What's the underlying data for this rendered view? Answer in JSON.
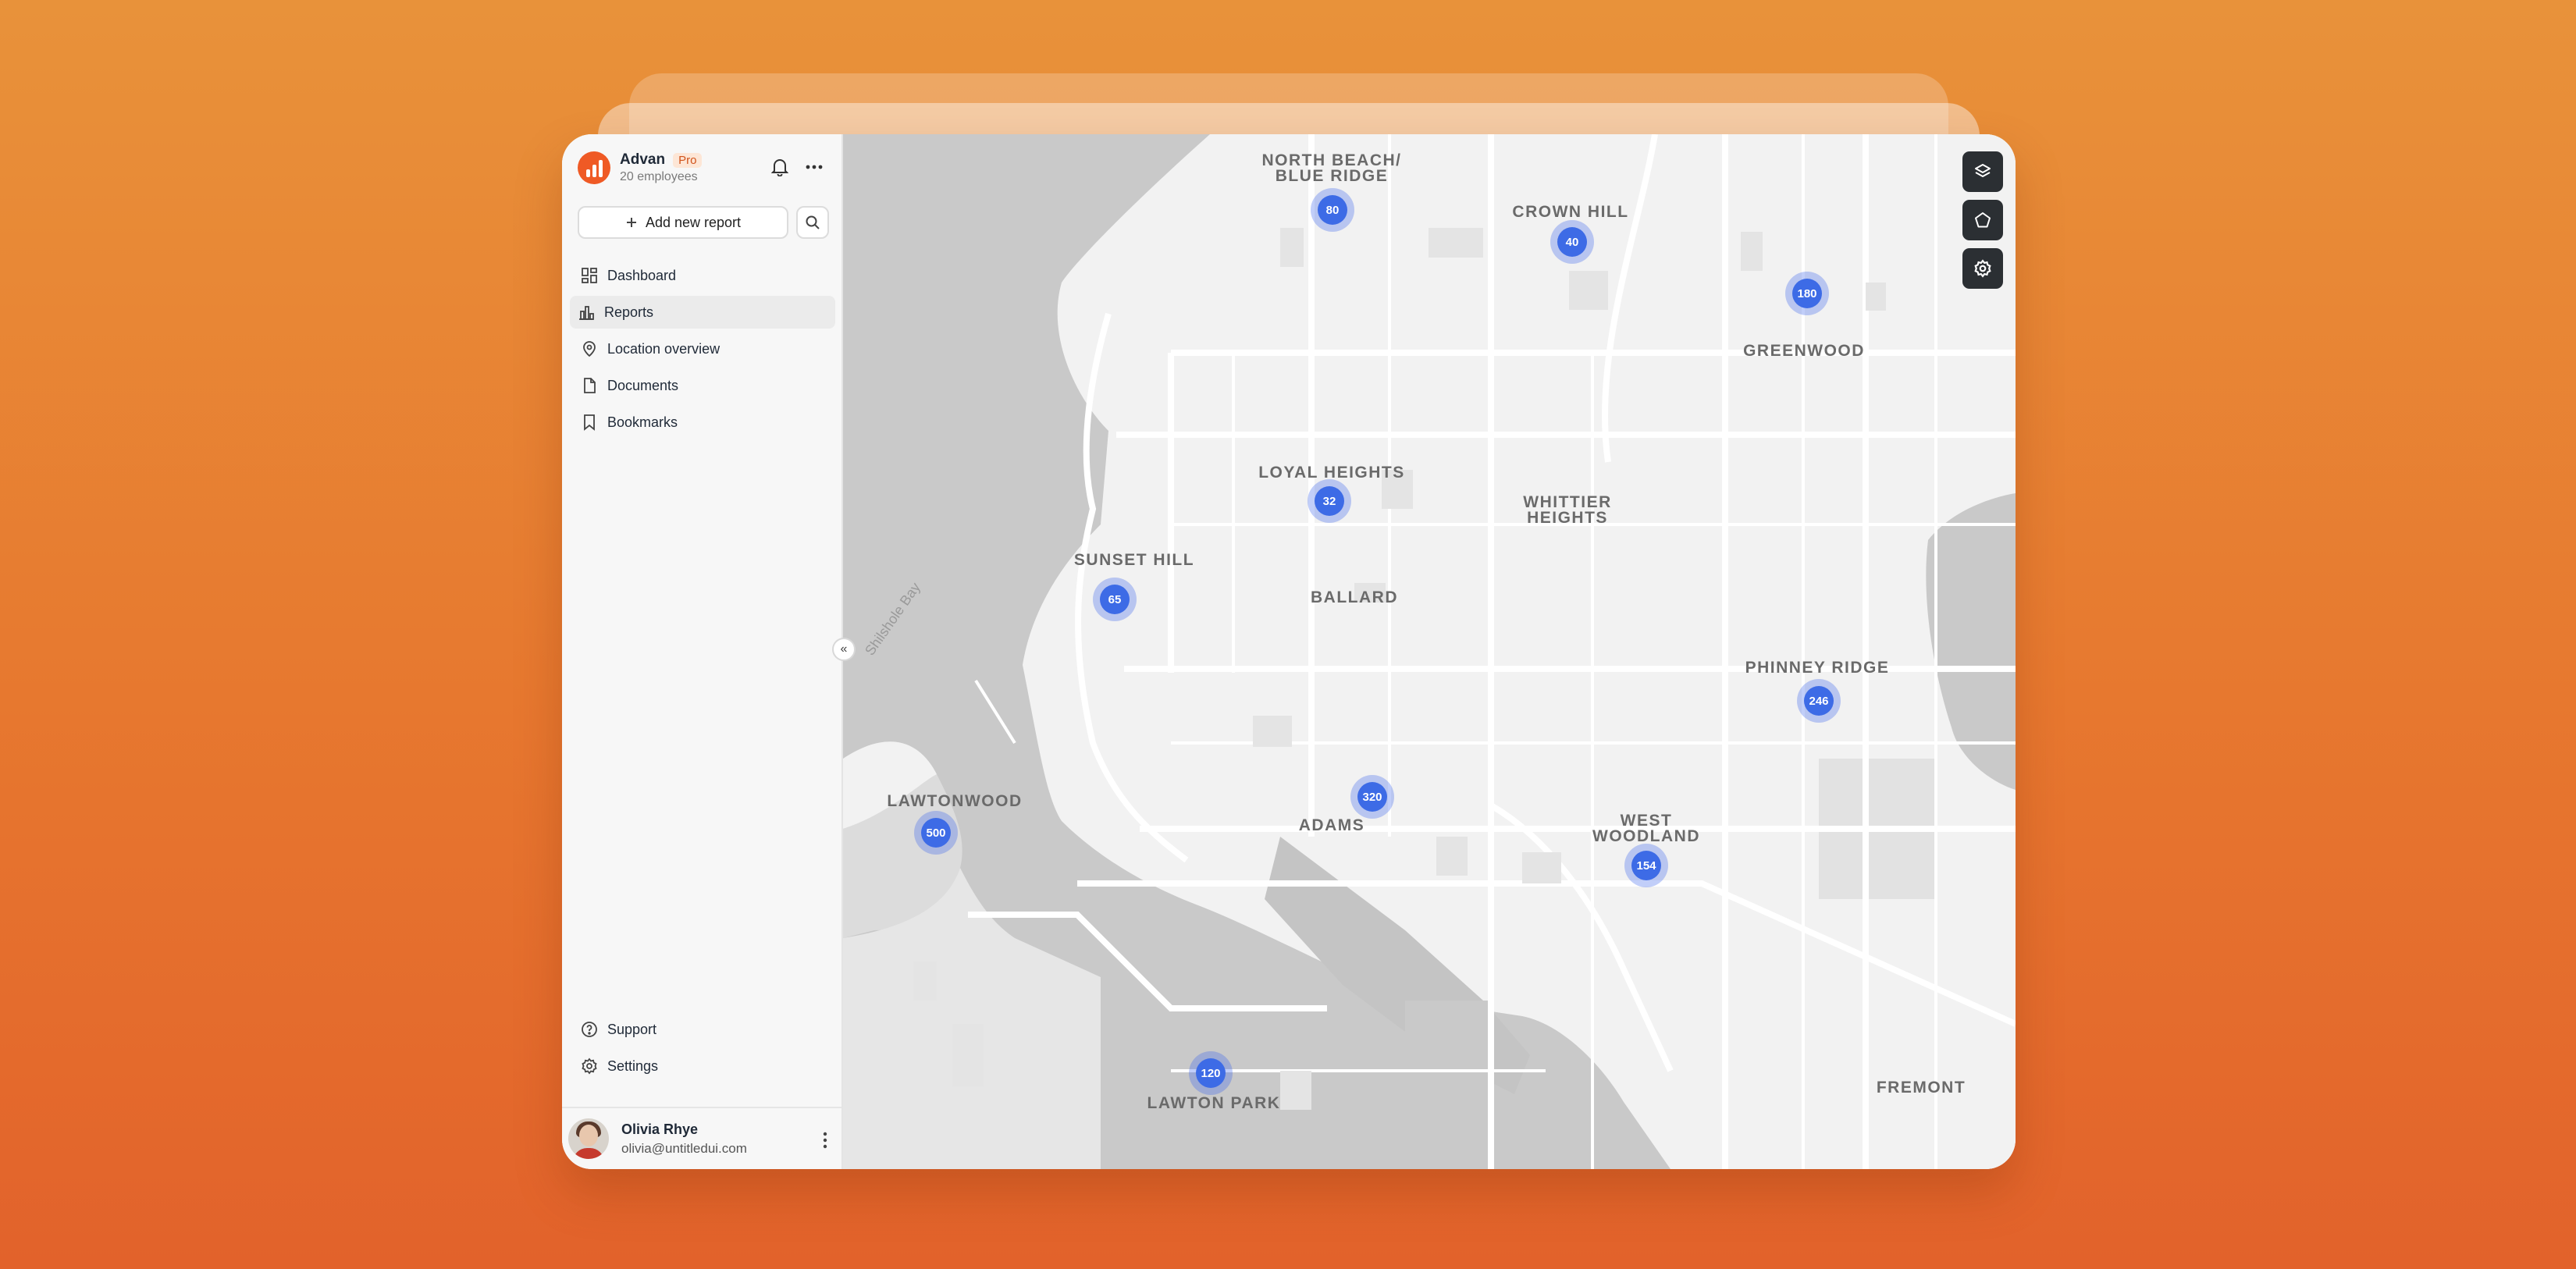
{
  "brand": {
    "name": "Advan",
    "badge": "Pro",
    "subtitle": "20 employees",
    "logo_color": "#ef5a25"
  },
  "header_icons": [
    "bell-icon",
    "more-horizontal-icon"
  ],
  "actions": {
    "add_report_label": "Add new report",
    "add_icon": "plus-icon",
    "search_icon": "search-icon"
  },
  "nav": {
    "items": [
      {
        "label": "Dashboard",
        "icon": "dashboard-icon",
        "active": false
      },
      {
        "label": "Reports",
        "icon": "bar-chart-icon",
        "active": true
      },
      {
        "label": "Location overview",
        "icon": "map-pin-icon",
        "active": false
      },
      {
        "label": "Documents",
        "icon": "file-icon",
        "active": false
      },
      {
        "label": "Bookmarks",
        "icon": "bookmark-icon",
        "active": false
      }
    ],
    "bottom": [
      {
        "label": "Support",
        "icon": "help-circle-icon"
      },
      {
        "label": "Settings",
        "icon": "settings-icon"
      }
    ]
  },
  "user": {
    "name": "Olivia Rhye",
    "email": "olivia@untitledui.com"
  },
  "collapse_label": "«",
  "map": {
    "water_label": "Shilshole Bay",
    "places": [
      "NORTH BEACH/\nBLUE RIDGE",
      "CROWN HILL",
      "GREENWOOD",
      "LOYAL HEIGHTS",
      "WHITTIER\nHEIGHTS",
      "SUNSET HILL",
      "BALLARD",
      "PHINNEY RIDGE",
      "LAWTONWOOD",
      "ADAMS",
      "WEST\nWOODLAND",
      "LAWTON PARK",
      "FREMONT"
    ],
    "clusters": [
      "80",
      "40",
      "180",
      "32",
      "65",
      "246",
      "320",
      "500",
      "154",
      "120"
    ],
    "cluster_color": "#3d6be6",
    "tools": [
      "layers-icon",
      "polygon-icon",
      "settings-icon"
    ]
  }
}
